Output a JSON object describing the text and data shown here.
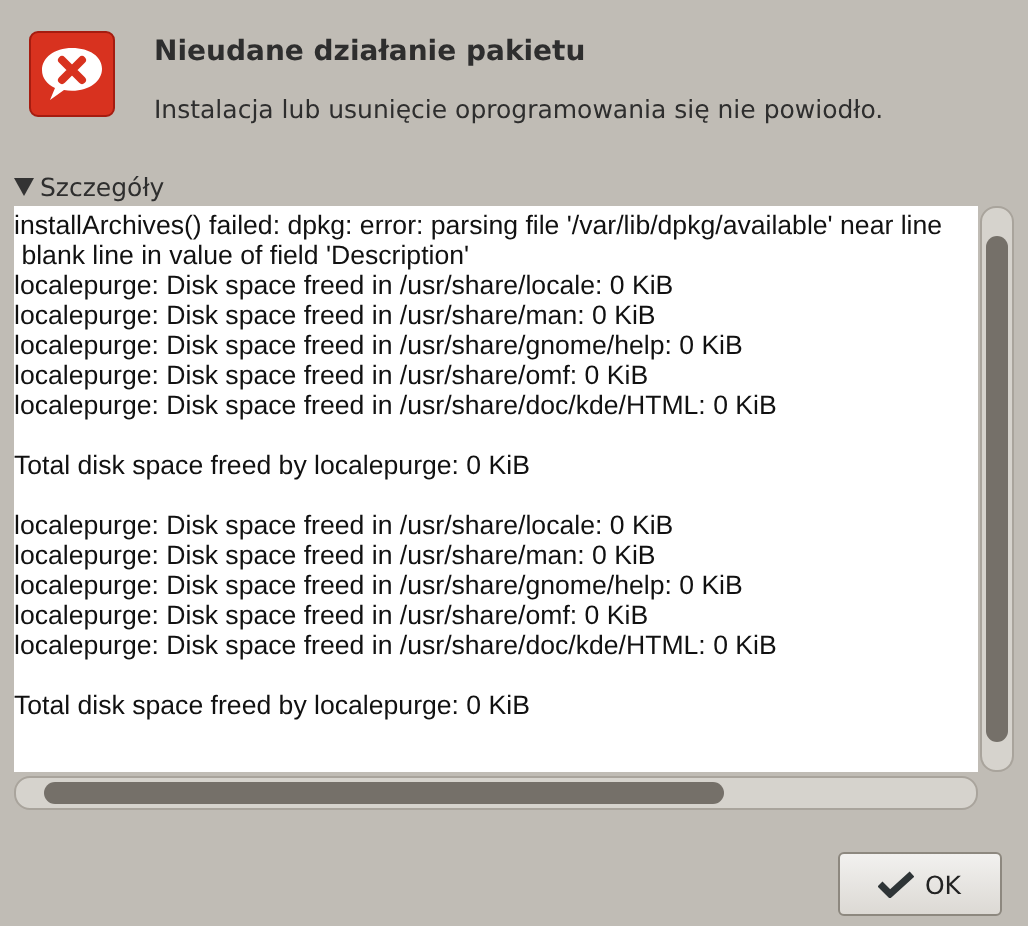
{
  "dialog": {
    "title": "Nieudane działanie pakietu",
    "message": "Instalacja lub usunięcie oprogramowania się nie powiodło."
  },
  "details": {
    "label": "Szczegóły",
    "expanded": true,
    "lines": [
      {
        "kind": "text",
        "text": "installArchives() failed: dpkg: error: parsing file '/var/lib/dpkg/available' near line"
      },
      {
        "kind": "text",
        "text": " blank line in value of field 'Description'"
      },
      {
        "kind": "text",
        "text": "localepurge: Disk space freed in /usr/share/locale: 0 KiB"
      },
      {
        "kind": "text",
        "text": "localepurge: Disk space freed in /usr/share/man: 0 KiB"
      },
      {
        "kind": "text",
        "text": "localepurge: Disk space freed in /usr/share/gnome/help: 0 KiB"
      },
      {
        "kind": "text",
        "text": "localepurge: Disk space freed in /usr/share/omf: 0 KiB"
      },
      {
        "kind": "text",
        "text": "localepurge: Disk space freed in /usr/share/doc/kde/HTML: 0 KiB"
      },
      {
        "kind": "blank"
      },
      {
        "kind": "text",
        "text": "Total disk space freed by localepurge: 0 KiB"
      },
      {
        "kind": "blank"
      },
      {
        "kind": "text",
        "text": "localepurge: Disk space freed in /usr/share/locale: 0 KiB"
      },
      {
        "kind": "text",
        "text": "localepurge: Disk space freed in /usr/share/man: 0 KiB"
      },
      {
        "kind": "text",
        "text": "localepurge: Disk space freed in /usr/share/gnome/help: 0 KiB"
      },
      {
        "kind": "text",
        "text": "localepurge: Disk space freed in /usr/share/omf: 0 KiB"
      },
      {
        "kind": "text",
        "text": "localepurge: Disk space freed in /usr/share/doc/kde/HTML: 0 KiB"
      },
      {
        "kind": "blank"
      },
      {
        "kind": "text",
        "text": "Total disk space freed by localepurge: 0 KiB"
      }
    ]
  },
  "buttons": [
    {
      "label": "OK"
    }
  ]
}
